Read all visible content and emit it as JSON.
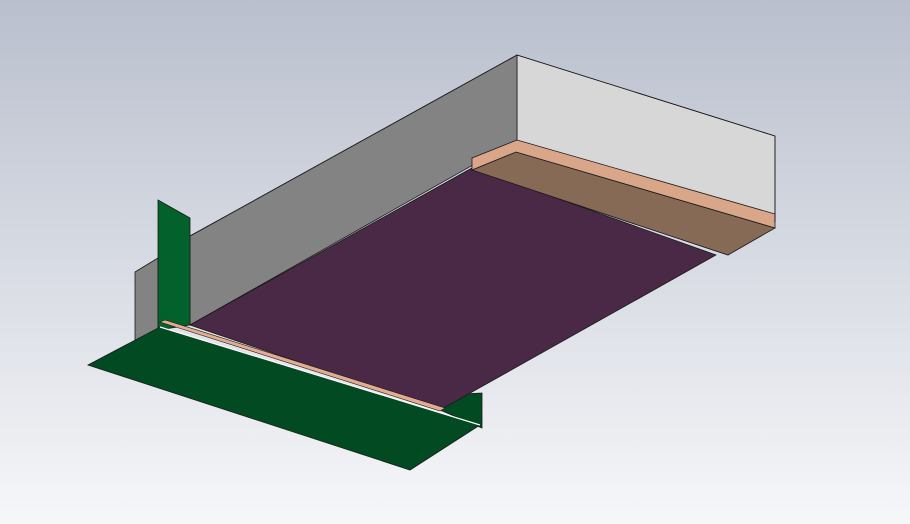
{
  "viewport": {
    "background_top": "#b9bfcd",
    "background_bottom": "#f6f7f9"
  },
  "model": {
    "side_wall_face": "#838383",
    "back_wall_face": "#d7d7d7",
    "ground_plane": "#4a2946",
    "feed_plane_light": "#03622b",
    "feed_plane_dark": "#014a22",
    "copper_block_top": "#d9a68a",
    "copper_block_side": "#876a56",
    "copper_strip": "#e3ab90",
    "edge_line": "#1a1a1a",
    "highlight_line": "#ffffff"
  }
}
